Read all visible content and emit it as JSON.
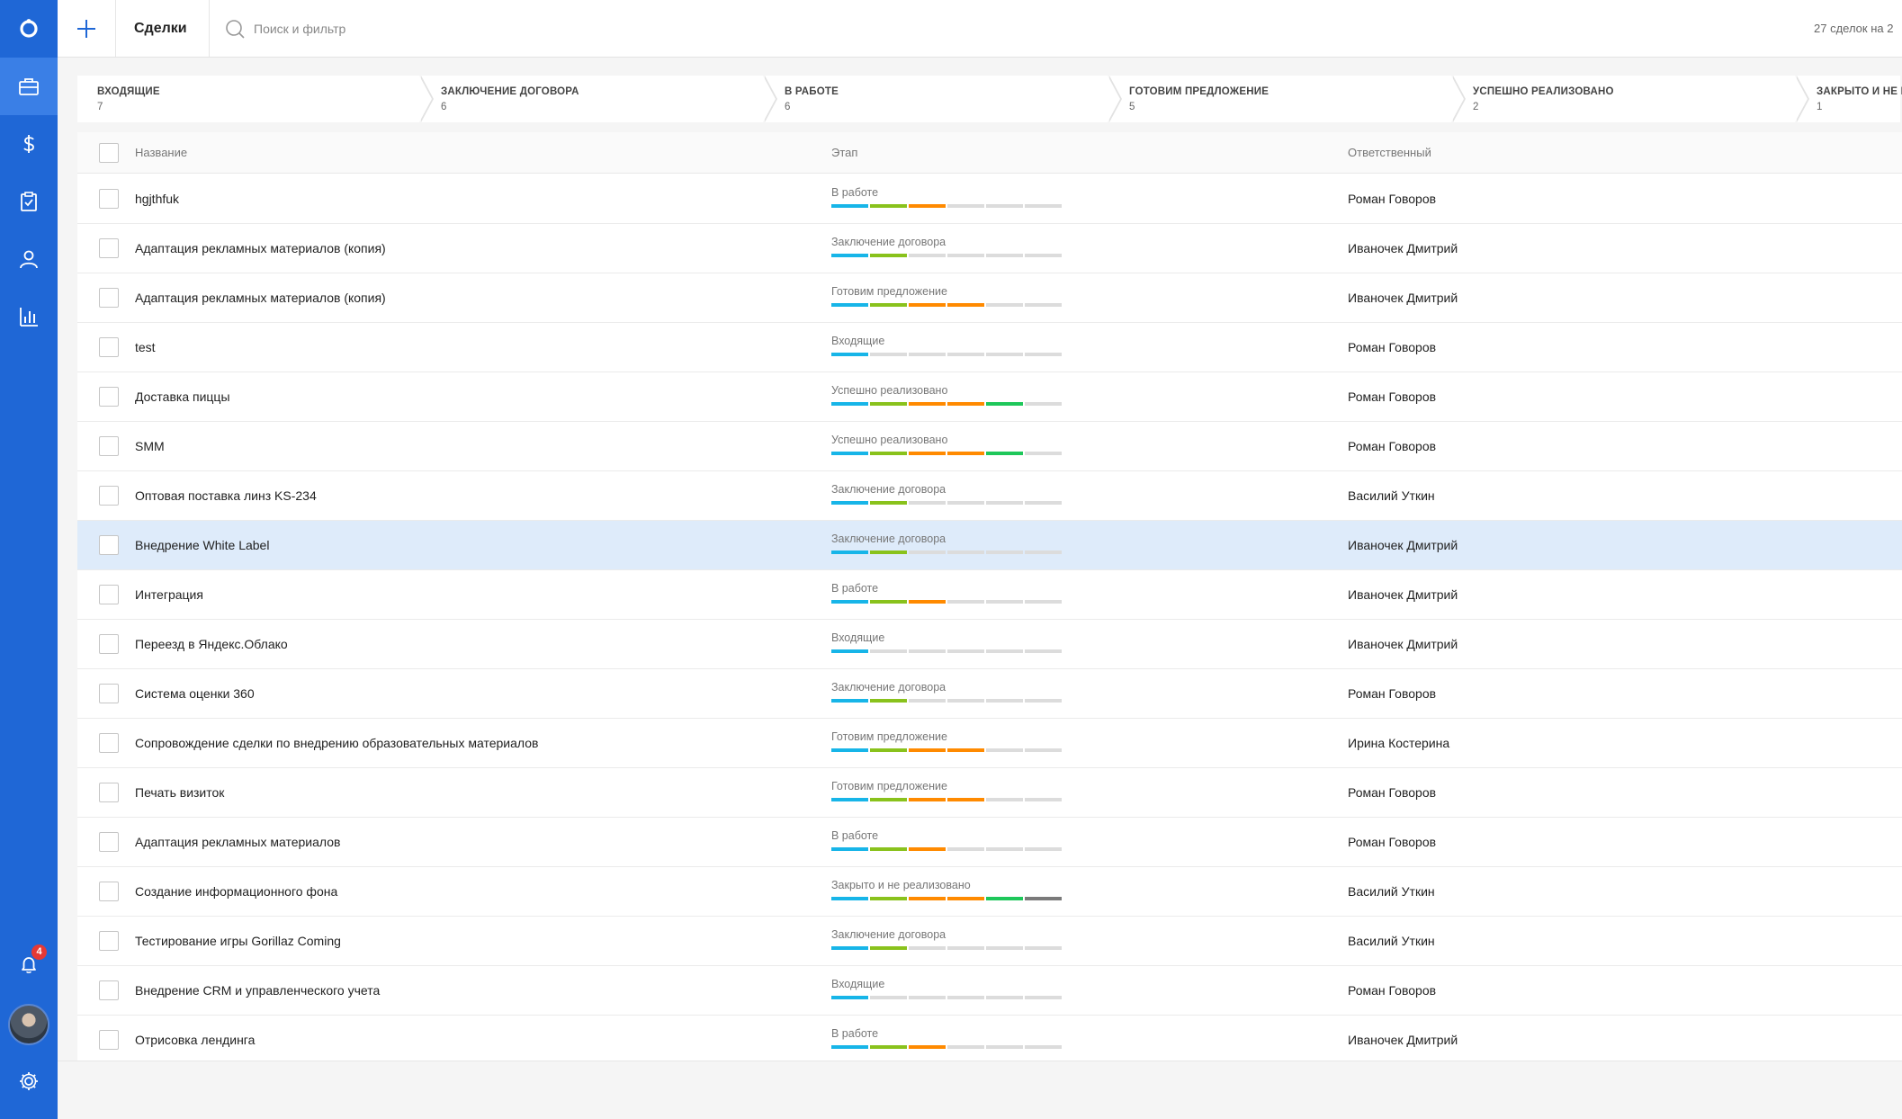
{
  "colors": {
    "sidebar": "#1f67d6",
    "selected_row": "#deebfa",
    "stage_colors": [
      "#17b5e8",
      "#89c21c",
      "#ff8a00",
      "#ff8a00",
      "#1ec75a",
      "#7a7a7a"
    ],
    "empty_segment": "#dcdcdc",
    "badge": "#e53935"
  },
  "sidebar": {
    "items": [
      {
        "icon": "logo-icon"
      },
      {
        "icon": "briefcase-icon",
        "active": true
      },
      {
        "icon": "dollar-icon"
      },
      {
        "icon": "task-checklist-icon"
      },
      {
        "icon": "user-icon"
      },
      {
        "icon": "bar-chart-icon"
      }
    ],
    "notifications_badge": "4"
  },
  "header": {
    "title": "Сделки",
    "search_placeholder": "Поиск и фильтр",
    "count_text": "27 сделок на 2"
  },
  "pipeline": [
    {
      "name": "ВХОДЯЩИЕ",
      "count": "7"
    },
    {
      "name": "ЗАКЛЮЧЕНИЕ ДОГОВОРА",
      "count": "6"
    },
    {
      "name": "В РАБОТЕ",
      "count": "6"
    },
    {
      "name": "ГОТОВИМ ПРЕДЛОЖЕНИЕ",
      "count": "5"
    },
    {
      "name": "УСПЕШНО РЕАЛИЗОВАНО",
      "count": "2"
    },
    {
      "name": "ЗАКРЫТО И НЕ Р",
      "count": "1"
    }
  ],
  "table": {
    "columns": {
      "name": "Название",
      "stage": "Этап",
      "owner": "Ответственный"
    },
    "rows": [
      {
        "name": "hgjthfuk",
        "stage": "В работе",
        "progress": 3,
        "owner": "Роман Говоров"
      },
      {
        "name": "Адаптация рекламных материалов (копия)",
        "stage": "Заключение договора",
        "progress": 2,
        "owner": "Иваночек Дмитрий"
      },
      {
        "name": "Адаптация рекламных материалов (копия)",
        "stage": "Готовим предложение",
        "progress": 4,
        "owner": "Иваночек Дмитрий"
      },
      {
        "name": "test",
        "stage": "Входящие",
        "progress": 1,
        "owner": "Роман Говоров"
      },
      {
        "name": "Доставка пиццы",
        "stage": "Успешно реализовано",
        "progress": 5,
        "owner": "Роман Говоров"
      },
      {
        "name": "SMM",
        "stage": "Успешно реализовано",
        "progress": 5,
        "owner": "Роман Говоров"
      },
      {
        "name": "Оптовая поставка линз KS-234",
        "stage": "Заключение договора",
        "progress": 2,
        "owner": "Василий Уткин"
      },
      {
        "name": "Внедрение White Label",
        "stage": "Заключение договора",
        "progress": 2,
        "owner": "Иваночек Дмитрий",
        "selected": true
      },
      {
        "name": "Интеграция",
        "stage": "В работе",
        "progress": 3,
        "owner": "Иваночек Дмитрий"
      },
      {
        "name": "Переезд в Яндекс.Облако",
        "stage": "Входящие",
        "progress": 1,
        "owner": "Иваночек Дмитрий"
      },
      {
        "name": "Система оценки 360",
        "stage": "Заключение договора",
        "progress": 2,
        "owner": "Роман Говоров"
      },
      {
        "name": "Сопровождение сделки по внедрению образовательных материалов",
        "stage": "Готовим предложение",
        "progress": 4,
        "owner": "Ирина Костерина"
      },
      {
        "name": "Печать визиток",
        "stage": "Готовим предложение",
        "progress": 4,
        "owner": "Роман Говоров"
      },
      {
        "name": "Адаптация рекламных материалов",
        "stage": "В работе",
        "progress": 3,
        "owner": "Роман Говоров"
      },
      {
        "name": "Создание информационного фона",
        "stage": "Закрыто и не реализовано",
        "progress": 6,
        "owner": "Василий Уткин"
      },
      {
        "name": "Тестирование игры Gorillaz Coming",
        "stage": "Заключение договора",
        "progress": 2,
        "owner": "Василий Уткин"
      },
      {
        "name": "Внедрение CRM и управленческого учета",
        "stage": "Входящие",
        "progress": 1,
        "owner": "Роман Говоров"
      },
      {
        "name": "Отрисовка лендинга",
        "stage": "В работе",
        "progress": 3,
        "owner": "Иваночек Дмитрий"
      }
    ]
  }
}
